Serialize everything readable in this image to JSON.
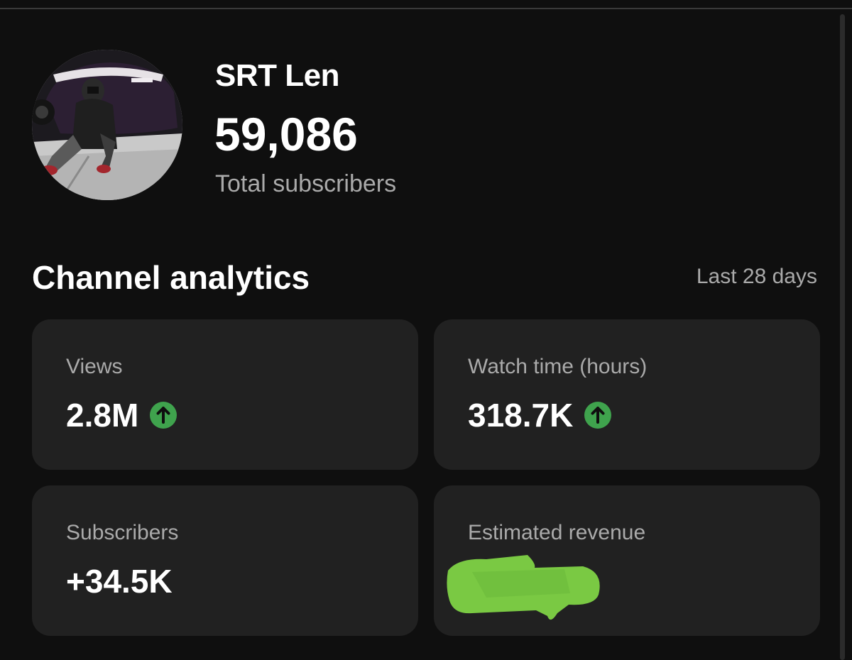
{
  "channel": {
    "name": "SRT Len",
    "subscriber_count": "59,086",
    "subscriber_label": "Total subscribers"
  },
  "analytics": {
    "title": "Channel analytics",
    "period": "Last 28 days",
    "cards": [
      {
        "label": "Views",
        "value": "2.8M",
        "trend": "up"
      },
      {
        "label": "Watch time (hours)",
        "value": "318.7K",
        "trend": "up"
      },
      {
        "label": "Subscribers",
        "value": "+34.5K",
        "trend": "none"
      },
      {
        "label": "Estimated revenue",
        "value": "",
        "trend": "none",
        "redacted": true
      }
    ]
  },
  "colors": {
    "background": "#0f0f0f",
    "card": "#212121",
    "trend_up": "#3fa34d",
    "redaction": "#7ac943",
    "muted_text": "#aaaaaa"
  },
  "icons": {
    "trend_up": "arrow-up-circle-icon"
  }
}
